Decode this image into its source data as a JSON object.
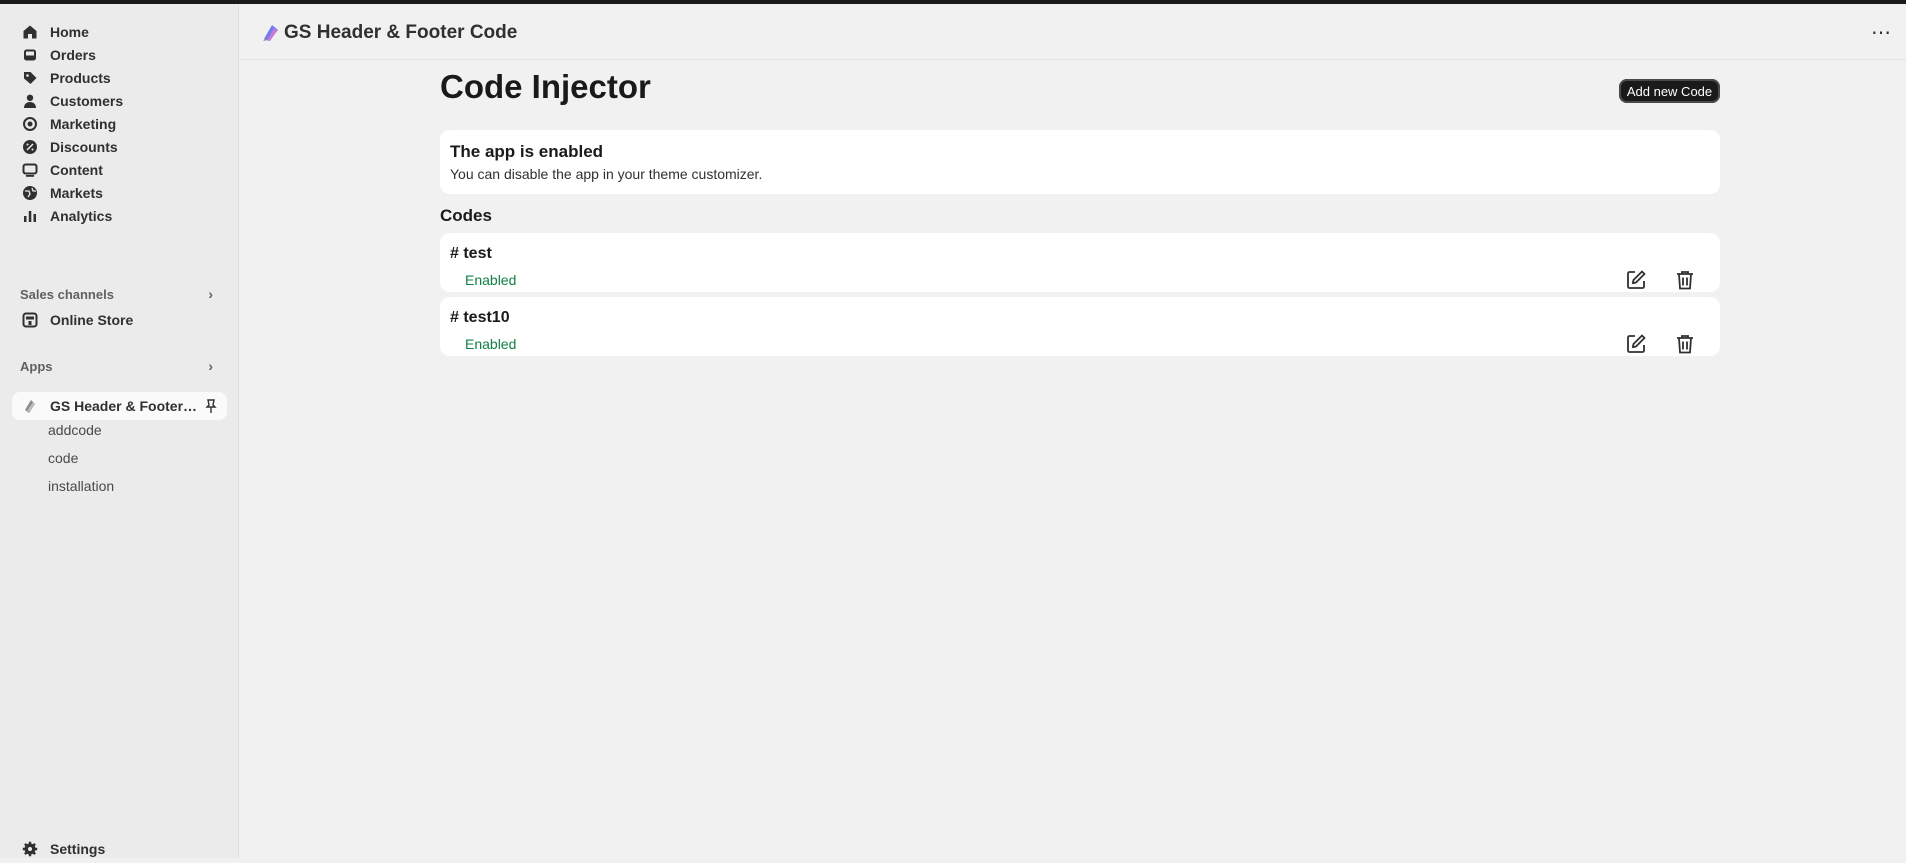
{
  "sidebar": {
    "items": [
      {
        "label": "Home",
        "icon": "home-icon"
      },
      {
        "label": "Orders",
        "icon": "inbox-icon"
      },
      {
        "label": "Products",
        "icon": "tag-icon"
      },
      {
        "label": "Customers",
        "icon": "person-icon"
      },
      {
        "label": "Marketing",
        "icon": "target-icon"
      },
      {
        "label": "Discounts",
        "icon": "discount-icon"
      },
      {
        "label": "Content",
        "icon": "content-icon"
      },
      {
        "label": "Markets",
        "icon": "globe-icon"
      },
      {
        "label": "Analytics",
        "icon": "bar-chart-icon"
      }
    ],
    "sales_channels": {
      "label": "Sales channels",
      "items": [
        {
          "label": "Online Store",
          "icon": "store-icon"
        }
      ]
    },
    "apps": {
      "label": "Apps",
      "app_label": "GS Header & Footer C...",
      "sub_items": [
        "addcode",
        "code",
        "installation"
      ]
    },
    "settings_label": "Settings"
  },
  "header": {
    "app_title": "GS Header & Footer Code",
    "more_label": "⋯"
  },
  "page": {
    "title": "Code Injector",
    "add_button_label": "Add new Code",
    "banner": {
      "title": "The app is enabled",
      "subtitle": "You can disable the app in your theme customizer."
    },
    "codes_heading": "Codes",
    "codes": [
      {
        "name": "# test",
        "status": "Enabled"
      },
      {
        "name": "# test10",
        "status": "Enabled"
      }
    ]
  },
  "colors": {
    "accent": "#1a1a1a",
    "status_enabled": "#108043",
    "background": "#f1f1f1",
    "sidebar": "#ebebeb"
  }
}
